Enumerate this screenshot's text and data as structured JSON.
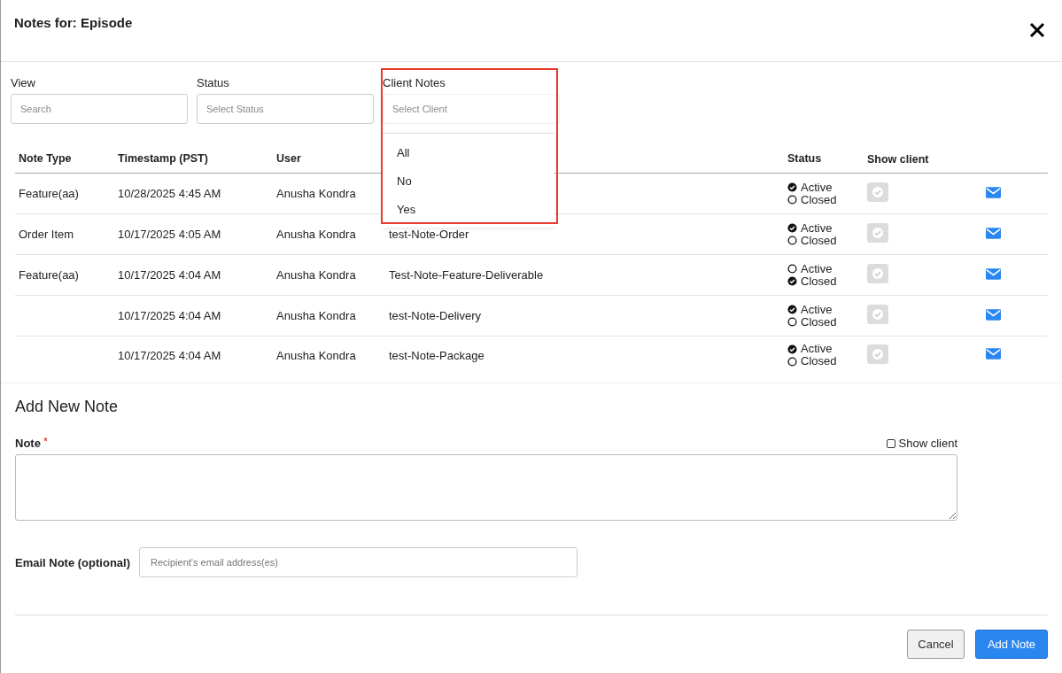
{
  "modal": {
    "title": "Notes for: Episode"
  },
  "filters": [
    {
      "label": "View",
      "placeholder": "Search"
    },
    {
      "label": "Status",
      "placeholder": "Select Status"
    },
    {
      "label": "Client Notes",
      "placeholder": "Select Client",
      "expanded": true,
      "options": [
        "All",
        "No",
        "Yes"
      ]
    }
  ],
  "table": {
    "columns": [
      "Note Type",
      "Timestamp (PST)",
      "User",
      "Status",
      "Show client"
    ],
    "rows": [
      {
        "note_type": "Feature(aa)",
        "timestamp": "10/28/2025 4:45 AM",
        "user": "Anusha Kondra",
        "note": "",
        "statuses": [
          {
            "label": "Active",
            "checked": true
          },
          {
            "label": "Closed",
            "checked": false
          }
        ]
      },
      {
        "note_type": "Order Item",
        "timestamp": "10/17/2025 4:05 AM",
        "user": "Anusha Kondra",
        "note": "test-Note-Order",
        "statuses": [
          {
            "label": "Active",
            "checked": true
          },
          {
            "label": "Closed",
            "checked": false
          }
        ]
      },
      {
        "note_type": "Feature(aa)",
        "timestamp": "10/17/2025 4:04 AM",
        "user": "Anusha Kondra",
        "note": "Test-Note-Feature-Deliverable",
        "statuses": [
          {
            "label": "Active",
            "checked": false
          },
          {
            "label": "Closed",
            "checked": true
          }
        ]
      },
      {
        "note_type": "",
        "timestamp": "10/17/2025 4:04 AM",
        "user": "Anusha Kondra",
        "note": "test-Note-Delivery",
        "statuses": [
          {
            "label": "Active",
            "checked": true
          },
          {
            "label": "Closed",
            "checked": false
          }
        ]
      },
      {
        "note_type": "",
        "timestamp": "10/17/2025 4:04 AM",
        "user": "Anusha Kondra",
        "note": "test-Note-Package",
        "statuses": [
          {
            "label": "Active",
            "checked": true
          },
          {
            "label": "Closed",
            "checked": false
          }
        ]
      }
    ]
  },
  "add_note": {
    "heading": "Add New Note",
    "note_label": "Note",
    "required_mark": "*",
    "show_client": {
      "label": "Show client",
      "checked": false
    },
    "email_label": "Email Note (optional)",
    "email_placeholder": "Recipient's email address(es)"
  },
  "buttons": [
    {
      "label": "Cancel",
      "kind": "secondary"
    },
    {
      "label": "Add Note",
      "kind": "primary"
    }
  ]
}
